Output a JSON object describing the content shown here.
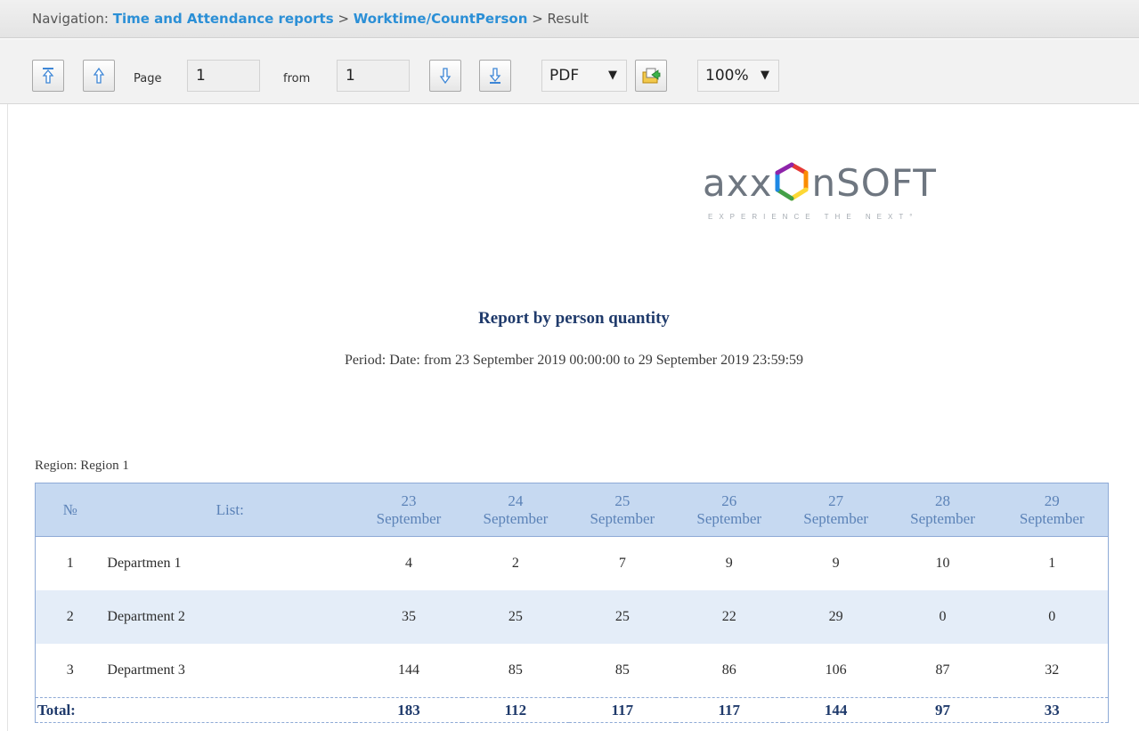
{
  "navigation": {
    "prefix": "Navigation:",
    "crumbs": [
      "Time and Attendance reports",
      "Worktime/CountPerson",
      "Result"
    ],
    "separator": ">"
  },
  "toolbar": {
    "page_label": "Page",
    "page_value": "1",
    "from_label": "from",
    "from_value": "1",
    "format": "PDF",
    "zoom": "100%"
  },
  "report": {
    "logo_text": "axxonsoft",
    "logo_tagline": "EXPERIENCE THE NEXT",
    "title": "Report by person quantity",
    "period": "Period: Date: from 23 September 2019 00:00:00 to 29 September 2019 23:59:59",
    "region": "Region: Region 1",
    "table": {
      "col_no": "№",
      "col_list": "List:",
      "days": [
        {
          "day": "23",
          "month": "September"
        },
        {
          "day": "24",
          "month": "September"
        },
        {
          "day": "25",
          "month": "September"
        },
        {
          "day": "26",
          "month": "September"
        },
        {
          "day": "27",
          "month": "September"
        },
        {
          "day": "28",
          "month": "September"
        },
        {
          "day": "29",
          "month": "September"
        }
      ],
      "rows": [
        {
          "no": "1",
          "name": "Departmen 1",
          "values": [
            "4",
            "2",
            "7",
            "9",
            "9",
            "10",
            "1"
          ]
        },
        {
          "no": "2",
          "name": "Department 2",
          "values": [
            "35",
            "25",
            "25",
            "22",
            "29",
            "0",
            "0"
          ]
        },
        {
          "no": "3",
          "name": "Department 3",
          "values": [
            "144",
            "85",
            "85",
            "86",
            "106",
            "87",
            "32"
          ]
        }
      ],
      "total_label": "Total:",
      "totals": [
        "183",
        "112",
        "117",
        "117",
        "144",
        "97",
        "33"
      ]
    }
  },
  "colors": {
    "nav_link": "#2b8fd6",
    "header_bg": "#c6d9f1",
    "header_text": "#5b82b7",
    "title_text": "#1f3a6b",
    "alt_row_bg": "#e4edf8"
  }
}
